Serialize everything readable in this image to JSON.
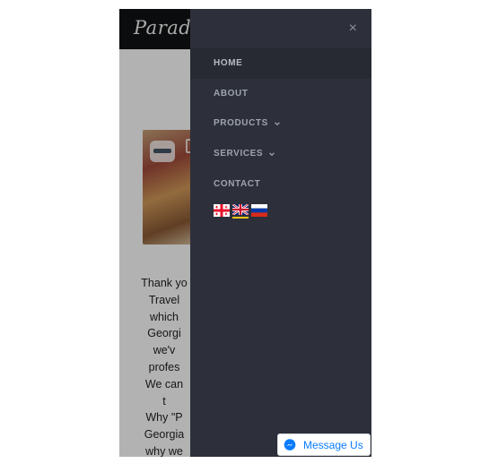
{
  "header": {
    "logo_text": "Paradi"
  },
  "content": {
    "body_lines": [
      "Thank yo",
      "Travel",
      "which",
      "Georgi",
      "we'v",
      "profes",
      "We can",
      "t",
      "Why \"P",
      "Georgia",
      "why we"
    ]
  },
  "drawer": {
    "close_glyph": "×",
    "nav_items": [
      {
        "label": "HOME",
        "active": true,
        "has_submenu": false
      },
      {
        "label": "ABOUT",
        "active": false,
        "has_submenu": false
      },
      {
        "label": "PRODUCTS",
        "active": false,
        "has_submenu": true
      },
      {
        "label": "SERVICES",
        "active": false,
        "has_submenu": true
      },
      {
        "label": "CONTACT",
        "active": false,
        "has_submenu": false
      }
    ],
    "languages": [
      {
        "icon": "georgia-flag-icon",
        "current": false
      },
      {
        "icon": "uk-flag-icon",
        "current": true
      },
      {
        "icon": "russia-flag-icon",
        "current": false
      }
    ]
  },
  "messenger": {
    "label": "Message Us",
    "icon": "messenger-icon",
    "color": "#0a7cff"
  },
  "colors": {
    "drawer_bg": "#2d303a",
    "drawer_active_bg": "#272a33",
    "header_bg": "#111213"
  }
}
